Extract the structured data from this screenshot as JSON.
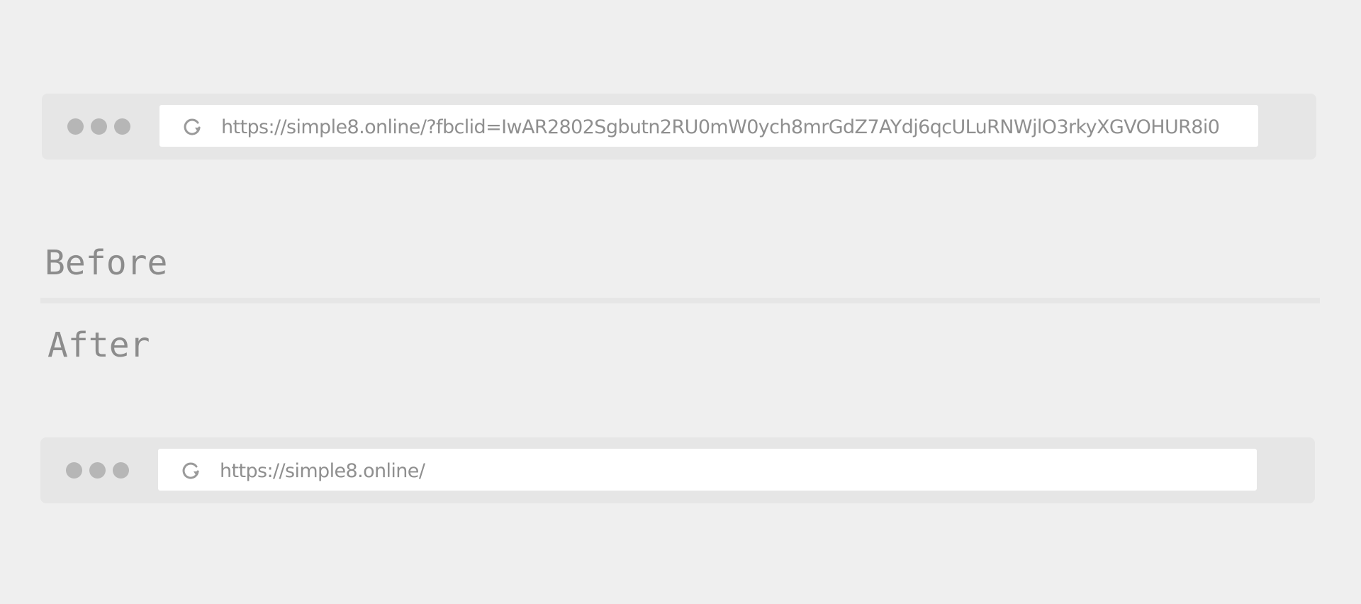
{
  "before": {
    "label": "Before",
    "url": "https://simple8.online/?fbclid=IwAR2802Sgbutn2RU0mW0ych8mrGdZ7AYdj6qcULuRNWjlO3rkyXGVOHUR8i0",
    "window_dots": [
      "dot",
      "dot",
      "dot"
    ],
    "reload_icon": "reload-icon"
  },
  "after": {
    "label": "After",
    "url": "https://simple8.online/",
    "window_dots": [
      "dot",
      "dot",
      "dot"
    ],
    "reload_icon": "reload-icon"
  },
  "colors": {
    "background": "#efefef",
    "bar": "#e6e6e6",
    "dot": "#b6b6b6",
    "field": "#ffffff",
    "text": "#8f8f8f"
  }
}
